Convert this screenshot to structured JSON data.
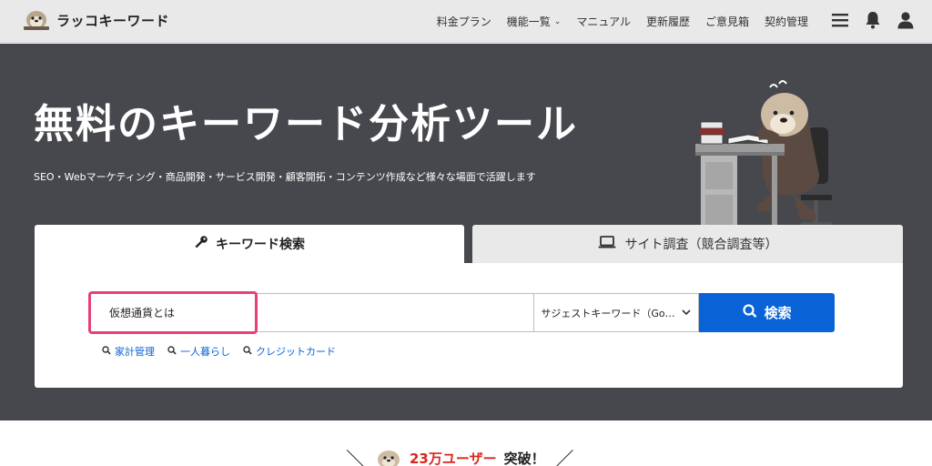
{
  "header": {
    "logo_text": "ラッコキーワード",
    "nav": [
      {
        "label": "料金プラン"
      },
      {
        "label": "機能一覧",
        "chevron": "⌄"
      },
      {
        "label": "マニュアル"
      },
      {
        "label": "更新履歴"
      },
      {
        "label": "ご意見箱"
      },
      {
        "label": "契約管理"
      }
    ],
    "icons": [
      "menu-icon",
      "bell-icon",
      "user-icon"
    ]
  },
  "hero": {
    "title": "無料のキーワード分析ツール",
    "subtitle": "SEO・Webマーケティング・商品開発・サービス開発・顧客開拓・コンテンツ作成など様々な場面で活躍します"
  },
  "tabs": {
    "keyword_search": "キーワード検索",
    "site_research": "サイト調査（競合調査等）"
  },
  "search": {
    "value": "仮想通貨とは",
    "select_value": "サジェストキーワード（Google）",
    "button_label": "検索",
    "suggestions": [
      "家計管理",
      "一人暮らし",
      "クレジットカード"
    ]
  },
  "banner": {
    "count": "23万ユーザー",
    "rest": "突破！"
  },
  "colors": {
    "accent": "#0a63d6",
    "highlight": "#e83f7a",
    "hero_bg": "#47484d"
  }
}
